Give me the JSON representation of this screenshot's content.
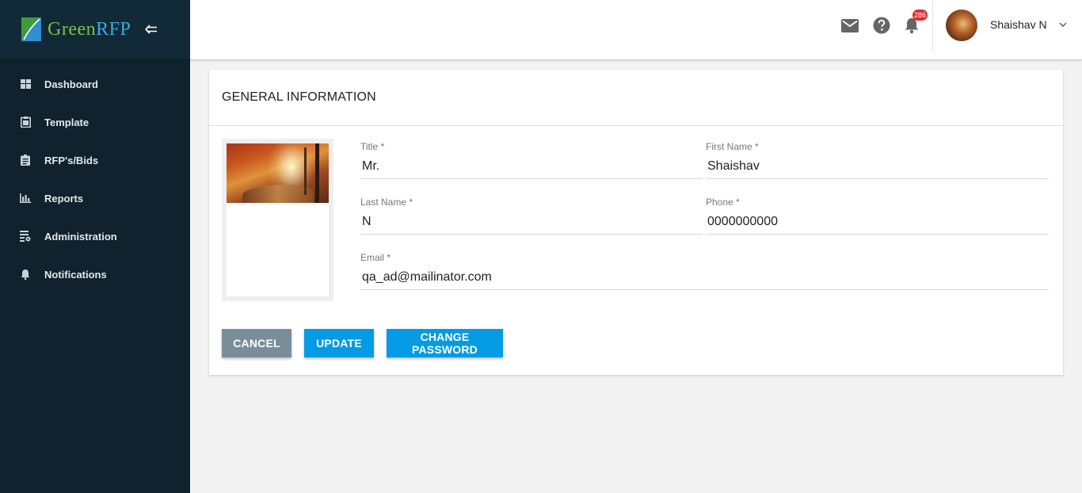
{
  "brand": {
    "name_part1": "Green",
    "name_part2": "RFP"
  },
  "sidebar": {
    "items": [
      {
        "label": "Dashboard",
        "icon": "dashboard-icon"
      },
      {
        "label": "Template",
        "icon": "clipboard-icon"
      },
      {
        "label": "RFP's/Bids",
        "icon": "assignment-icon"
      },
      {
        "label": "Reports",
        "icon": "bar-chart-icon"
      },
      {
        "label": "Administration",
        "icon": "admin-icon"
      },
      {
        "label": "Notifications",
        "icon": "bell-icon"
      }
    ]
  },
  "header": {
    "notification_count": "286",
    "user_name": "Shaishav N",
    "icons": [
      "mail-icon",
      "help-icon",
      "bell-icon",
      "chevron-down-icon"
    ]
  },
  "card": {
    "title": "GENERAL INFORMATION",
    "fields": {
      "title": {
        "label": "Title",
        "required": "*",
        "value": "Mr."
      },
      "first_name": {
        "label": "First Name",
        "required": "*",
        "value": "Shaishav"
      },
      "last_name": {
        "label": "Last Name",
        "required": "*",
        "value": "N"
      },
      "phone": {
        "label": "Phone",
        "required": "*",
        "value": "0000000000"
      },
      "email": {
        "label": "Email",
        "required": "*",
        "value": "qa_ad@mailinator.com"
      }
    },
    "buttons": {
      "cancel": "CANCEL",
      "update": "UPDATE",
      "change_password": "CHANGE PASSWORD"
    }
  },
  "colors": {
    "sidebar_bg": "#0f222d",
    "brand_green": "#7cc242",
    "brand_blue": "#3fa8dd",
    "primary_button": "#039be5",
    "cancel_button": "#798e9a",
    "badge": "#e32c2c"
  }
}
